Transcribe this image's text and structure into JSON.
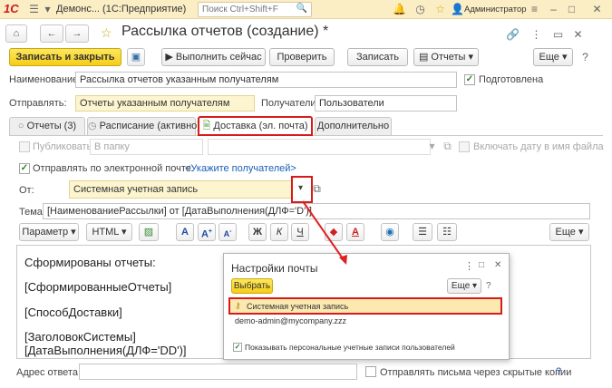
{
  "app": {
    "logo": "1С",
    "title": "Демонс... (1С:Предприятие)",
    "search_placeholder": "Поиск Ctrl+Shift+F",
    "user": "Администратор"
  },
  "form": {
    "title": "Рассылка отчетов (создание) *"
  },
  "toolbar": {
    "save_close": "Записать и закрыть",
    "run_now": "Выполнить сейчас",
    "check": "Проверить",
    "write": "Записать",
    "reports": "Отчеты",
    "more": "Еще"
  },
  "fields": {
    "name_label": "Наименование:",
    "name_value": "Рассылка отчетов указанным получателям",
    "prepared_label": "Подготовлена",
    "send_label": "Отправлять:",
    "send_value": "Отчеты указанным получателям",
    "recipients_label": "Получатели:",
    "recipients_value": "Пользователи"
  },
  "tabs": [
    {
      "label": "Отчеты (3)"
    },
    {
      "label": "Расписание (активно)"
    },
    {
      "label": "Доставка (эл. почта)"
    },
    {
      "label": "Дополнительно"
    }
  ],
  "delivery": {
    "publish_label": "Публиковать",
    "folder_value": "В папку",
    "include_date_label": "Включать дату в имя файла",
    "send_email_label": "Отправлять по электронной почте:",
    "recipients_link": "<Укажите получателей>",
    "from_label": "От:",
    "from_value": "Системная учетная запись",
    "subject_label": "Тема:",
    "subject_value": "[НаименованиеРассылки] от [ДатаВыполнения(ДЛФ='D')]",
    "param_btn": "Параметр",
    "html_btn": "HTML",
    "bold": "Ж",
    "italic": "К",
    "underline": "Ч",
    "font_a": "A",
    "font_a_up": "A",
    "font_a_down": "A",
    "font_color": "A",
    "more": "Еще",
    "reply_label": "Адрес ответа:",
    "hidden_copies_label": "Отправлять письма через скрытые копии",
    "help": "?"
  },
  "editor": {
    "lines": [
      "Сформированы отчеты:",
      "[СформированныеОтчеты]",
      "[СпособДоставки]",
      "[ЗаголовокСистемы]",
      "[ДатаВыполнения(ДЛФ='DD')]"
    ]
  },
  "popup": {
    "title": "Настройки почты",
    "select_btn": "Выбрать",
    "more": "Еще",
    "accounts": [
      "Системная учетная запись",
      "demo-admin@mycompany.zzz"
    ],
    "show_personal_label": "Показывать персональные учетные записи пользователей"
  },
  "colors": {
    "accent_yellow": "#f6cd17",
    "highlight_red": "#d91a1a",
    "link_blue": "#1a5fb4",
    "brand_red": "#d0161b"
  }
}
